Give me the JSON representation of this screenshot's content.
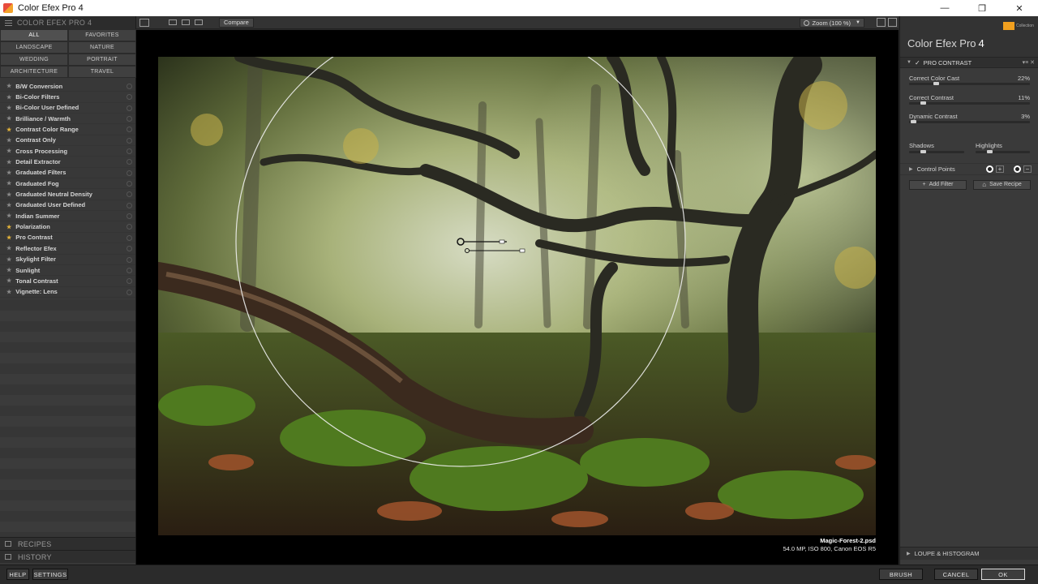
{
  "window": {
    "title": "Color Efex Pro 4",
    "minimize": "—",
    "maximize": "❐",
    "close": "✕"
  },
  "left_panel": {
    "header": "COLOR EFEX PRO 4",
    "categories": [
      {
        "label": "ALL",
        "active": true
      },
      {
        "label": "FAVORITES",
        "active": false
      },
      {
        "label": "LANDSCAPE",
        "active": false
      },
      {
        "label": "NATURE",
        "active": false
      },
      {
        "label": "WEDDING",
        "active": false
      },
      {
        "label": "PORTRAIT",
        "active": false
      },
      {
        "label": "ARCHITECTURE",
        "active": false
      },
      {
        "label": "TRAVEL",
        "active": false
      }
    ],
    "filters": [
      {
        "label": "B/W Conversion",
        "favorite": false
      },
      {
        "label": "Bi-Color Filters",
        "favorite": false
      },
      {
        "label": "Bi-Color User Defined",
        "favorite": false
      },
      {
        "label": "Brilliance / Warmth",
        "favorite": false
      },
      {
        "label": "Contrast Color Range",
        "favorite": true
      },
      {
        "label": "Contrast Only",
        "favorite": false
      },
      {
        "label": "Cross Processing",
        "favorite": false
      },
      {
        "label": "Detail Extractor",
        "favorite": false
      },
      {
        "label": "Graduated Filters",
        "favorite": false
      },
      {
        "label": "Graduated Fog",
        "favorite": false
      },
      {
        "label": "Graduated Neutral Density",
        "favorite": false
      },
      {
        "label": "Graduated User Defined",
        "favorite": false
      },
      {
        "label": "Indian Summer",
        "favorite": false
      },
      {
        "label": "Polarization",
        "favorite": true
      },
      {
        "label": "Pro Contrast",
        "favorite": true
      },
      {
        "label": "Reflector Efex",
        "favorite": false
      },
      {
        "label": "Skylight Filter",
        "favorite": false
      },
      {
        "label": "Sunlight",
        "favorite": false
      },
      {
        "label": "Tonal Contrast",
        "favorite": false
      },
      {
        "label": "Vignette: Lens",
        "favorite": false
      }
    ],
    "recipes_label": "RECIPES",
    "history_label": "HISTORY"
  },
  "toolbar": {
    "compare_label": "Compare",
    "zoom_label": "Zoom (100 %)"
  },
  "photo": {
    "filename": "Magic-Forest-2.psd",
    "meta": "54.0 MP, ISO 800, Canon EOS R5"
  },
  "right_panel": {
    "brand_name": "Color Efex Pro",
    "brand_version": "4",
    "badge_text": "Collection",
    "filter_name": "PRO CONTRAST",
    "sliders": [
      {
        "label": "Correct Color Cast",
        "value": "22%",
        "fraction": 0.22
      },
      {
        "label": "Correct Contrast",
        "value": "11%",
        "fraction": 0.11
      },
      {
        "label": "Dynamic Contrast",
        "value": "3%",
        "fraction": 0.03
      }
    ],
    "shadows_label": "Shadows",
    "highlights_label": "Highlights",
    "control_points_label": "Control Points",
    "add_filter_label": "Add Filter",
    "save_recipe_label": "Save Recipe",
    "loupe_label": "LOUPE & HISTOGRAM"
  },
  "bottom_bar": {
    "help": "HELP",
    "settings": "SETTINGS",
    "brush": "BRUSH",
    "cancel": "CANCEL",
    "ok": "OK"
  }
}
